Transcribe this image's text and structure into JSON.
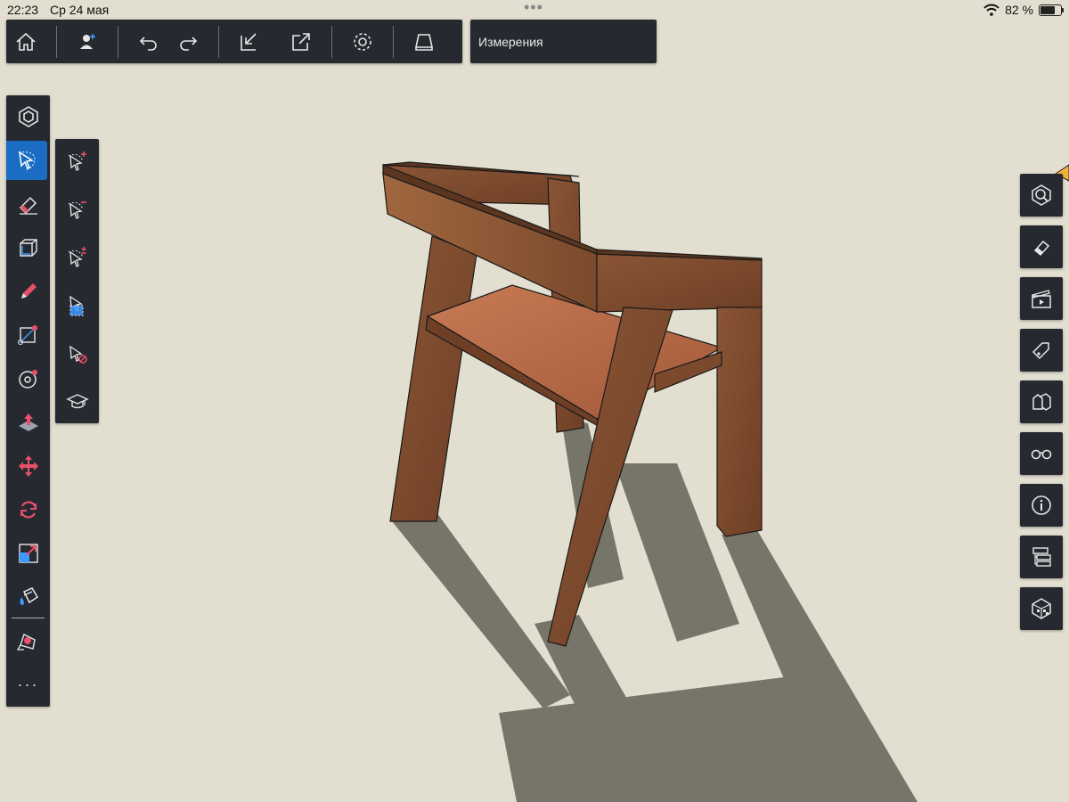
{
  "status_bar": {
    "time": "22:23",
    "date": "Ср 24 мая",
    "battery_percent_label": "82 %",
    "battery_level": 0.82
  },
  "toolbar": {
    "buttons": [
      {
        "icon": "home-icon"
      },
      {
        "icon": "add-user-icon"
      },
      {
        "icon": "undo-icon"
      },
      {
        "icon": "redo-icon"
      },
      {
        "icon": "import-icon"
      },
      {
        "icon": "export-icon"
      },
      {
        "icon": "settings-icon"
      },
      {
        "icon": "display-icon"
      }
    ]
  },
  "model_panel": {
    "title": "Измерения"
  },
  "left_toolbar": {
    "tools": [
      "select-tool-icon",
      "eraser-icon",
      "tag-box-icon",
      "pencil-icon",
      "rectangle-icon",
      "circle-icon",
      "push-pull-icon",
      "move-icon",
      "rotate-icon",
      "scale-icon",
      "paint-bucket-icon",
      "tape-measure-icon"
    ],
    "active": "select-tool-icon",
    "more_label": "···"
  },
  "select_flyout": {
    "tools": [
      "select-add-icon",
      "select-subtract-icon",
      "select-toggle-icon",
      "select-components-icon",
      "select-none-icon",
      "select-learn-icon"
    ]
  },
  "right_toolbar": {
    "buttons": [
      "view-icon",
      "eraser-display-icon",
      "scenes-icon",
      "tags-icon",
      "components-icon",
      "x-ray-icon",
      "info-icon",
      "outliner-icon",
      "materials-icon"
    ]
  },
  "colors": {
    "panel_bg": "#262a30",
    "active_blue": "#1a6dc2",
    "canvas_bg": "#e3dfd0",
    "wood": "#7a4a2e",
    "accent_red": "#e8506a"
  }
}
